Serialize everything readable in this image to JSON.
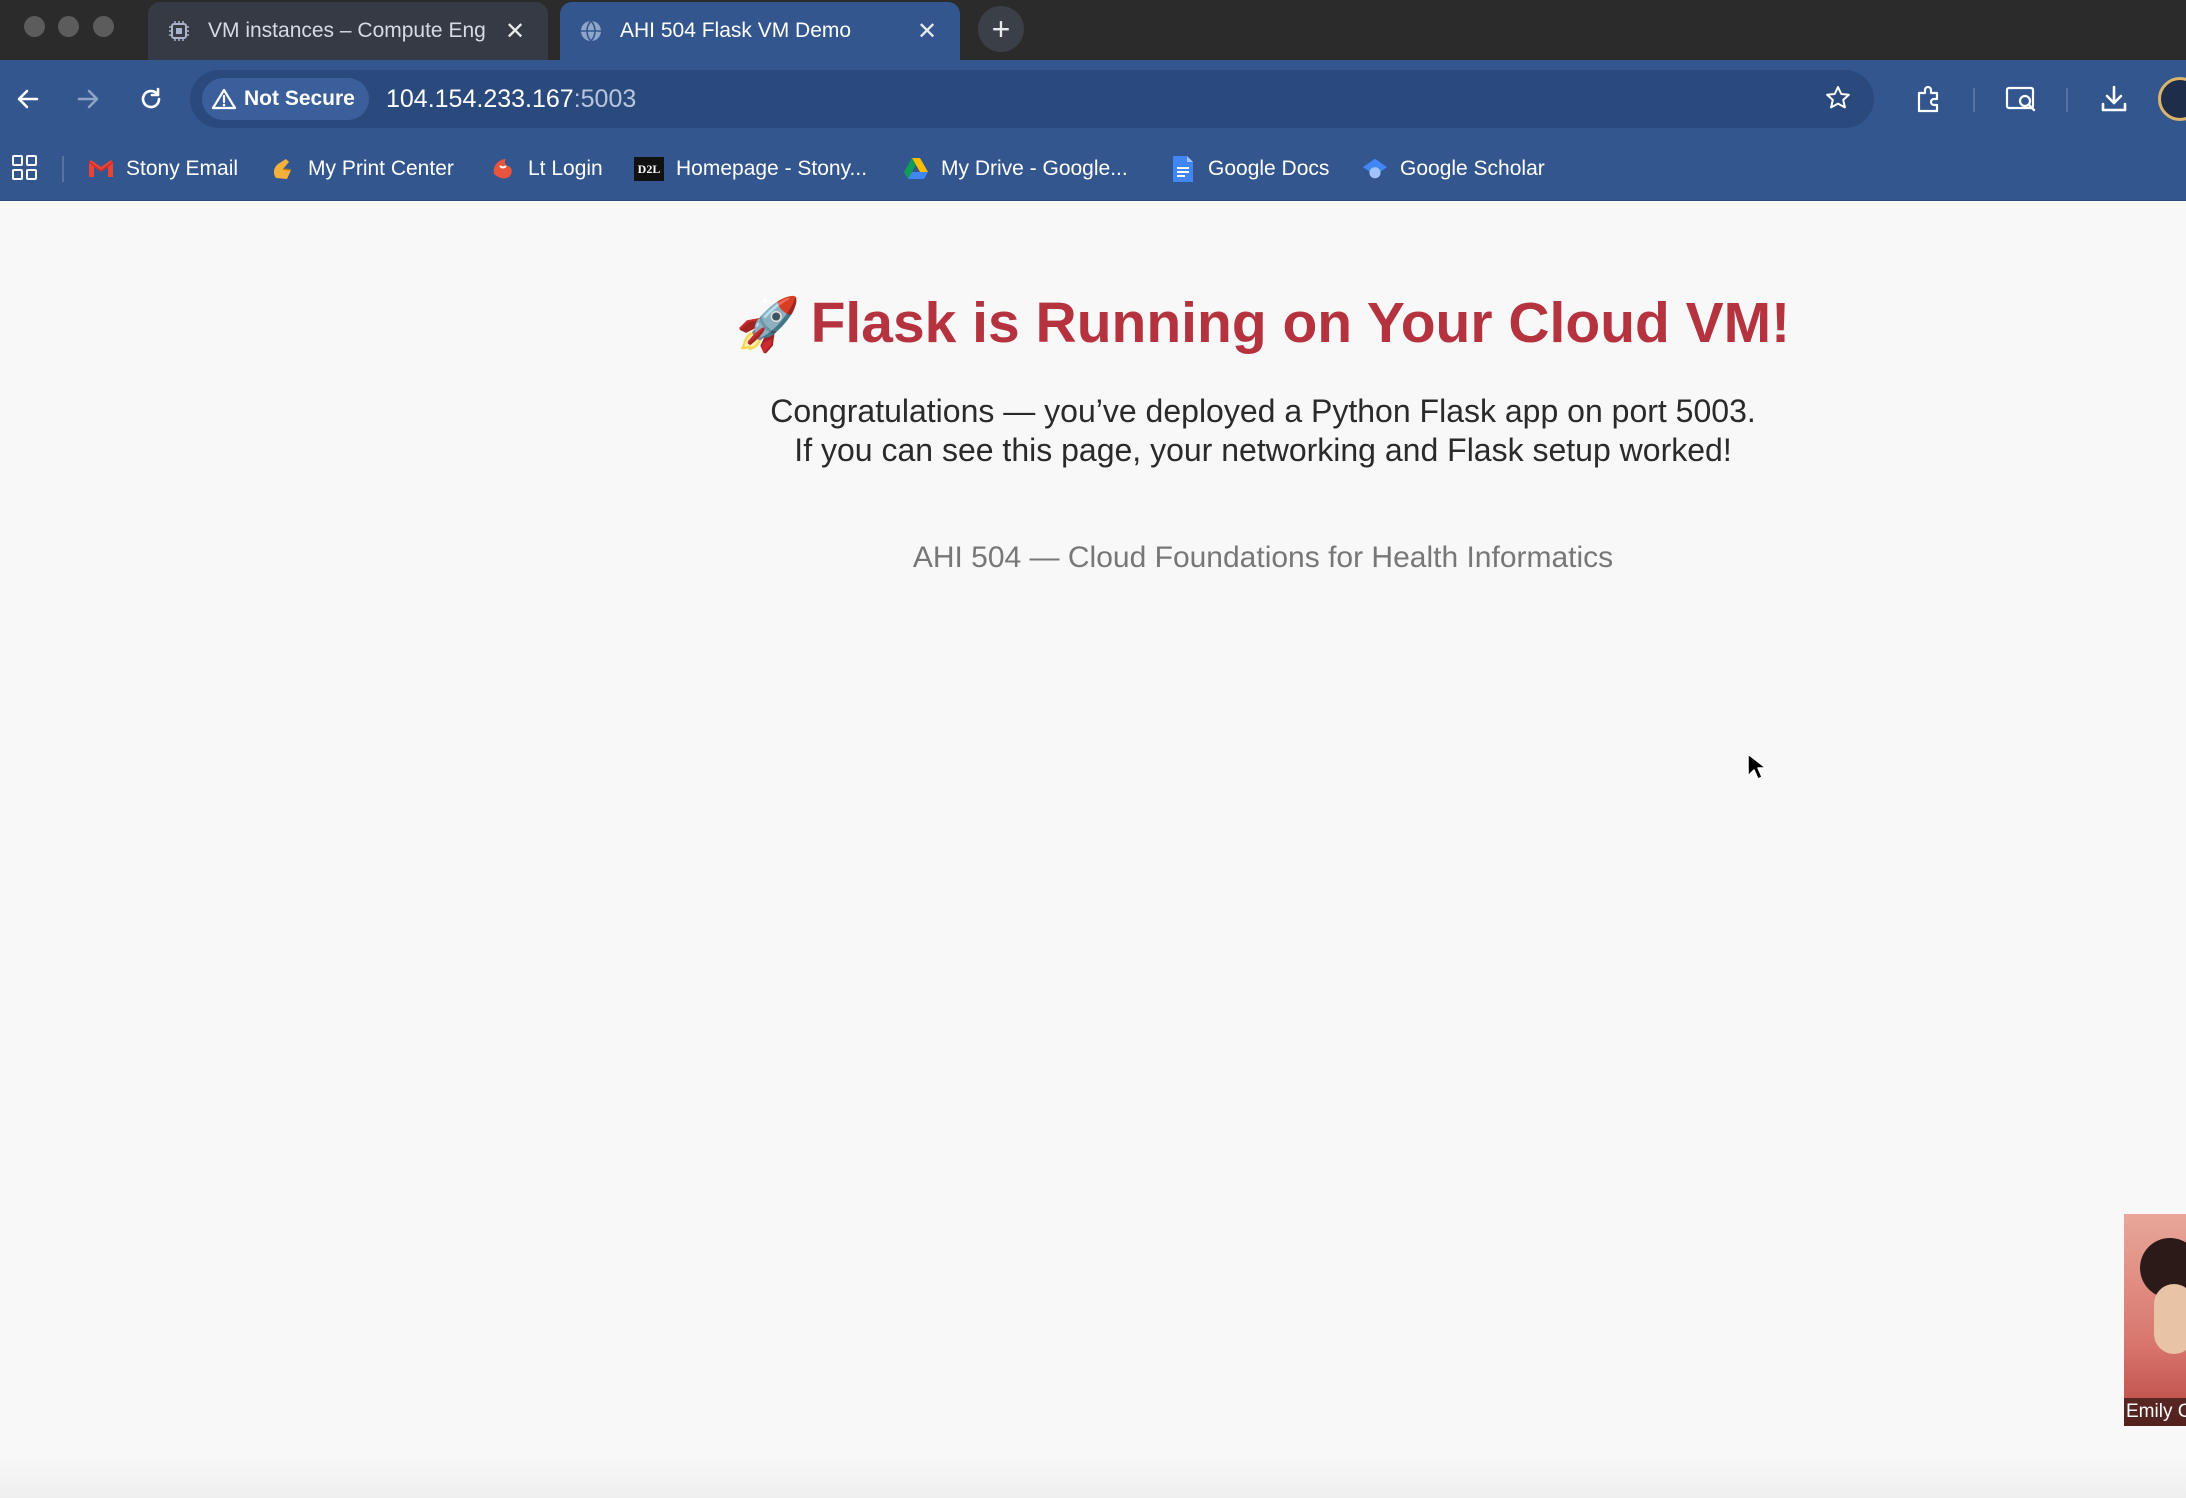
{
  "browser": {
    "tabs": [
      {
        "title": "VM instances – Compute Eng",
        "icon": "compute-engine-icon",
        "active": false
      },
      {
        "title": "AHI 504 Flask VM Demo",
        "icon": "globe-icon",
        "active": true
      }
    ],
    "new_tab_label": "+",
    "security_label": "Not Secure",
    "url_host": "104.154.233.167",
    "url_port": ":5003",
    "bookmarks": [
      {
        "label": "Stony Email",
        "icon": "gmail-icon"
      },
      {
        "label": "My Print Center",
        "icon": "print-center-icon"
      },
      {
        "label": "Lt Login",
        "icon": "lt-login-icon"
      },
      {
        "label": "Homepage - Stony...",
        "icon": "d2l-icon",
        "icon_text": "D2L"
      },
      {
        "label": "My Drive - Google...",
        "icon": "google-drive-icon"
      },
      {
        "label": "Google Docs",
        "icon": "google-docs-icon"
      },
      {
        "label": "Google Scholar",
        "icon": "google-scholar-icon"
      }
    ]
  },
  "page": {
    "emoji": "🚀",
    "heading": "Flask is Running on Your Cloud VM!",
    "line1": "Congratulations — you’ve deployed a Python Flask app on port 5003.",
    "line2": "If you can see this page, your networking and Flask setup worked!",
    "footer": "AHI 504 — Cloud Foundations for Health Informatics"
  },
  "webcam": {
    "name": "Emily C"
  },
  "colors": {
    "heading": "#b5333f",
    "toolbar": "#33568f",
    "tabstrip": "#2b2b2b"
  }
}
